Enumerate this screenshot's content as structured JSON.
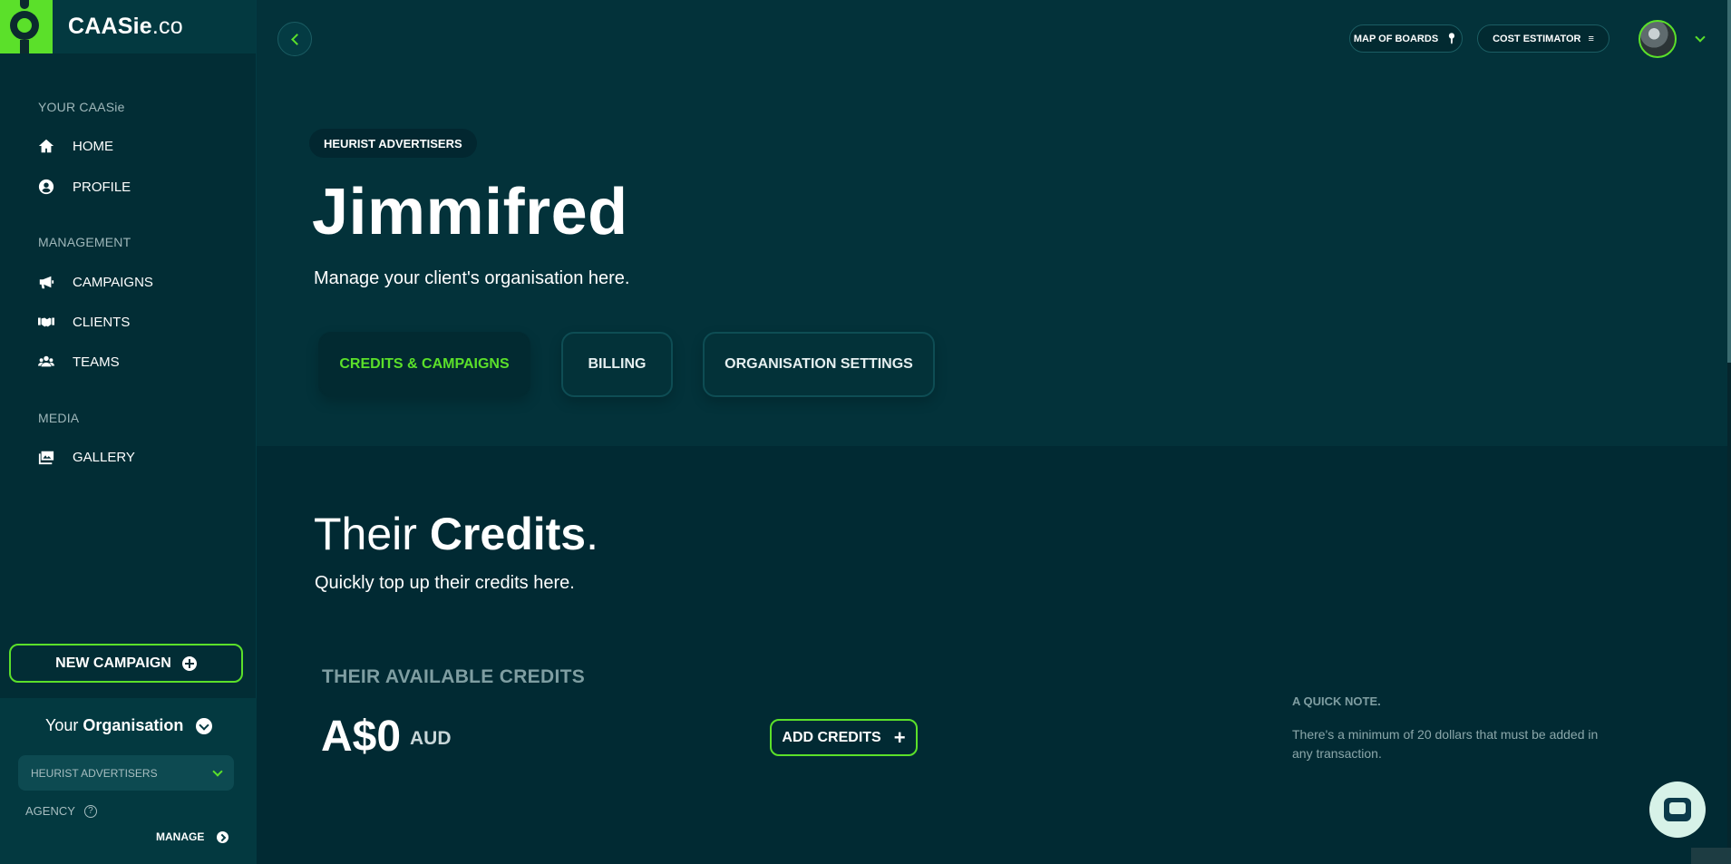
{
  "brand": {
    "name": "CAASie",
    "tld": ".co"
  },
  "sidebar": {
    "sections": [
      {
        "title": "YOUR CAASie"
      },
      {
        "title": "MANAGEMENT"
      },
      {
        "title": "MEDIA"
      }
    ],
    "items": [
      {
        "label": "HOME",
        "icon": "home-icon"
      },
      {
        "label": "PROFILE",
        "icon": "user-circle-icon"
      },
      {
        "label": "CAMPAIGNS",
        "icon": "megaphone-icon"
      },
      {
        "label": "CLIENTS",
        "icon": "handshake-icon"
      },
      {
        "label": "TEAMS",
        "icon": "users-icon"
      },
      {
        "label": "GALLERY",
        "icon": "images-icon"
      }
    ],
    "new_campaign_label": "NEW CAMPAIGN",
    "org": {
      "prefix": "Your",
      "title": "Organisation",
      "selected": "HEURIST ADVERTISERS",
      "type_label": "AGENCY",
      "help_glyph": "?",
      "manage_label": "MANAGE"
    }
  },
  "header": {
    "map_of_boards": "MAP OF BOARDS",
    "cost_estimator": "COST ESTIMATOR"
  },
  "main": {
    "org_tag": "HEURIST ADVERTISERS",
    "title": "Jimmifred",
    "subtitle": "Manage your client's organisation here.",
    "tabs": [
      {
        "label": "CREDITS & CAMPAIGNS",
        "active": true
      },
      {
        "label": "BILLING",
        "active": false
      },
      {
        "label": "ORGANISATION SETTINGS",
        "active": false
      }
    ]
  },
  "credits": {
    "title_light": "Their",
    "title_bold": "Credits",
    "title_end": ".",
    "subtitle": "Quickly top up their credits here.",
    "available_label": "THEIR AVAILABLE CREDITS",
    "amount": "A$0",
    "currency": "AUD",
    "add_label": "ADD CREDITS",
    "note_title": "A QUICK NOTE.",
    "note_text": "There's a minimum of 20 dollars that must be added in any transaction."
  },
  "colors": {
    "accent": "#5be02a",
    "background": "#012a33",
    "panel": "#03323a"
  }
}
